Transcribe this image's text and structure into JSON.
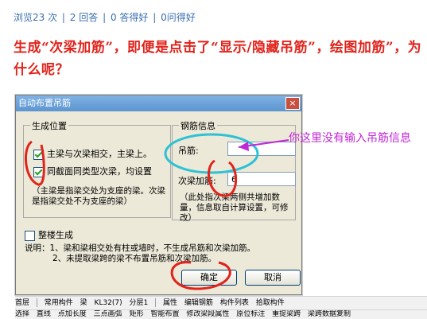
{
  "stats": {
    "views": "浏览23 次",
    "answers": "2 回答",
    "good": "0 答得好",
    "asks": "0问得好",
    "sep": "|"
  },
  "question": "生成“次梁加筋”，即便是点击了“显示/隐藏吊筋”，绘图加筋”，为什么呢？",
  "dialog": {
    "title": "自动布置吊筋",
    "close": "×",
    "position_group": "生成位置",
    "opt1": "主梁与次梁相交，主梁上。",
    "opt2": "同截面同类型次梁，均设置",
    "note": "（主梁是指梁交处为支座的梁。次梁是指梁交处不为支座的梁）",
    "rebar_group": "钢筋信息",
    "hanger_label": "吊筋:",
    "hanger_value": "",
    "secondary_label": "次梁加筋:",
    "secondary_value": "6",
    "rebar_note": "（此处指次梁两侧共增加数量，信息取自计算设置，可修改）",
    "whole_floor": "整楼生成",
    "explain_line1": "说明：1、梁和梁相交处有柱或墙时，不生成吊筋和次梁加筋。",
    "explain_line2": "2、未提取梁跨的梁不布置吊筋和次梁加筋。",
    "ok": "确定",
    "cancel": "取消"
  },
  "annotation": "你这里没有输入吊筋信息",
  "toolbar1": [
    "首层",
    "常用构件",
    "梁",
    "KL32(7)",
    "分层1",
    "属性",
    "编辑钢筋",
    "构件列表",
    "拾取构件"
  ],
  "toolbar2": [
    "选择",
    "直线",
    "点加长度",
    "三点画弧",
    "矩形",
    "智能布置",
    "修改梁段属性",
    "原位标注",
    "重提梁跨",
    "梁跨数据复制"
  ],
  "colors": {
    "annotation_red": "#e0231b",
    "annotation_magenta": "#c227d6",
    "annotation_cyan": "#2ec1d6"
  }
}
